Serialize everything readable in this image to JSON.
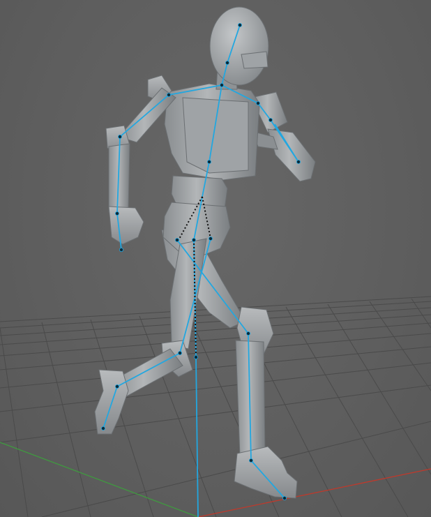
{
  "scene": {
    "background_color": "#5f5f5f",
    "grid_color": "#4a4a4a",
    "x_axis_color": "#c0392b",
    "z_axis_color": "#3f9a3f",
    "skeleton_color": "#22a7e0",
    "joint_color": "#0a2a3a",
    "mesh_color": "#a9acae",
    "mesh_shadow_color": "#7d8184",
    "character": "robot-mannequin",
    "pose": "running"
  }
}
